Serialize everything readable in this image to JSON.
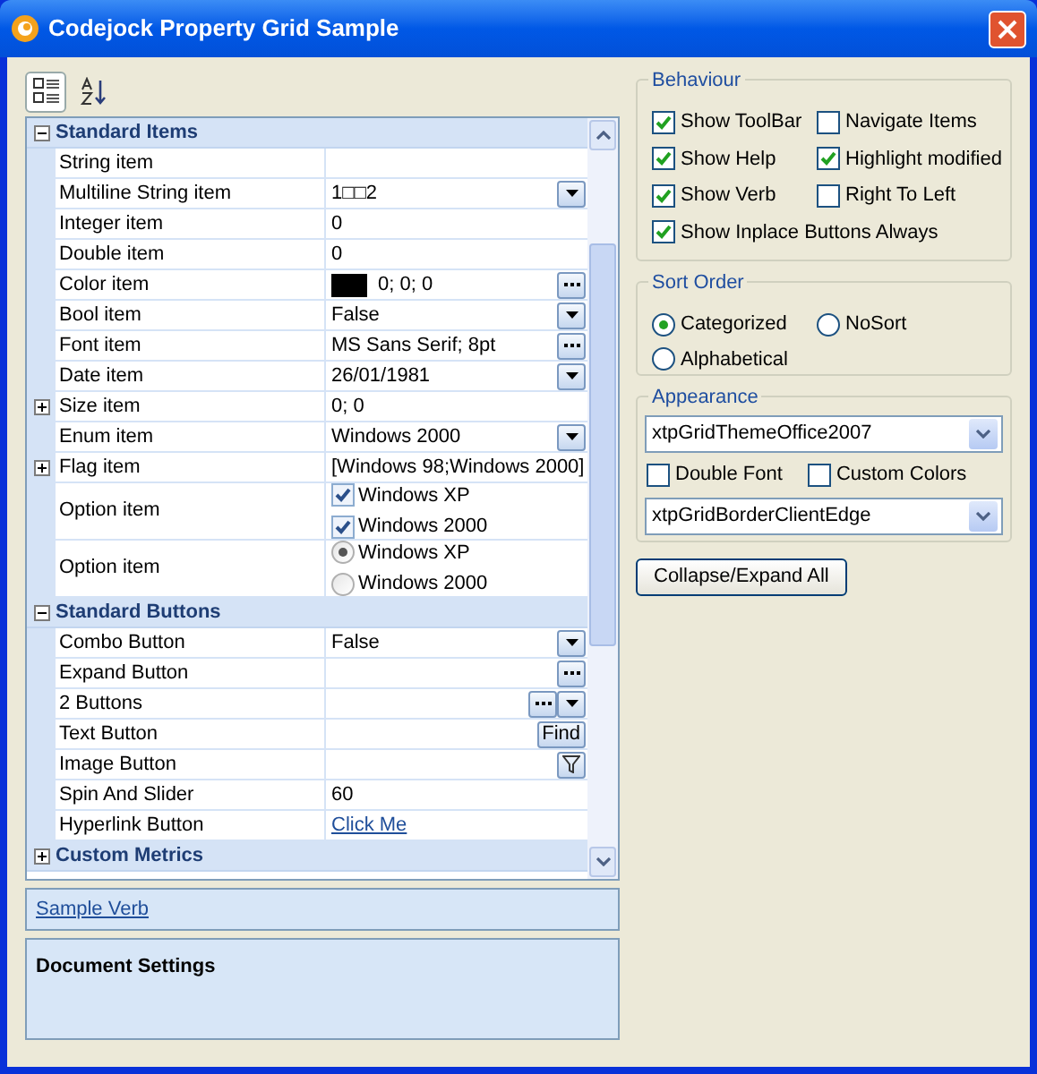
{
  "window": {
    "title": "Codejock Property Grid Sample"
  },
  "toolbar": [
    {
      "kind": "categorized",
      "selected": true
    },
    {
      "kind": "alphabetical",
      "selected": false
    }
  ],
  "grid": {
    "rows": [
      {
        "kind": "category",
        "label": "Standard Items",
        "expanded": true
      },
      {
        "kind": "item",
        "label": "String item",
        "value": ""
      },
      {
        "kind": "item",
        "label": "Multiline String item",
        "value": "1□□2",
        "buttons": [
          {
            "kind": "dropdown"
          }
        ]
      },
      {
        "kind": "item",
        "label": "Integer item",
        "value": "0"
      },
      {
        "kind": "item",
        "label": "Double item",
        "value": "0"
      },
      {
        "kind": "item",
        "label": "Color item",
        "value": "0; 0; 0",
        "color": "#000000",
        "buttons": [
          {
            "kind": "ellipsis"
          }
        ]
      },
      {
        "kind": "item",
        "label": "Bool item",
        "value": "False",
        "buttons": [
          {
            "kind": "dropdown"
          }
        ]
      },
      {
        "kind": "item",
        "label": "Font item",
        "value": "MS Sans Serif; 8pt",
        "buttons": [
          {
            "kind": "ellipsis"
          }
        ]
      },
      {
        "kind": "item",
        "label": "Date item",
        "value": "26/01/1981",
        "buttons": [
          {
            "kind": "dropdown"
          }
        ]
      },
      {
        "kind": "item",
        "label": "Size item",
        "value": "0; 0",
        "expanded": false
      },
      {
        "kind": "item",
        "label": "Enum item",
        "value": "Windows 2000",
        "buttons": [
          {
            "kind": "dropdown"
          }
        ]
      },
      {
        "kind": "item",
        "label": "Flag item",
        "value": "[Windows 98;Windows 2000]",
        "expanded": false
      },
      {
        "kind": "checks",
        "label": "Option item",
        "options": [
          {
            "label": "Windows XP",
            "checked": true
          },
          {
            "label": "Windows 2000",
            "checked": true
          }
        ]
      },
      {
        "kind": "radios",
        "label": "Option item",
        "options": [
          {
            "label": "Windows XP",
            "selected": true
          },
          {
            "label": "Windows 2000",
            "selected": false
          }
        ]
      },
      {
        "kind": "category",
        "label": "Standard Buttons",
        "expanded": true
      },
      {
        "kind": "item",
        "label": "Combo Button",
        "value": "False",
        "buttons": [
          {
            "kind": "dropdown"
          }
        ]
      },
      {
        "kind": "item",
        "label": "Expand Button",
        "value": "",
        "buttons": [
          {
            "kind": "ellipsis"
          }
        ]
      },
      {
        "kind": "item",
        "label": "2 Buttons",
        "value": "",
        "buttons": [
          {
            "kind": "ellipsis"
          },
          {
            "kind": "dropdown"
          }
        ]
      },
      {
        "kind": "item",
        "label": "Text Button",
        "value": "",
        "buttons": [
          {
            "kind": "text",
            "label": "Find"
          }
        ]
      },
      {
        "kind": "item",
        "label": "Image Button",
        "value": "",
        "buttons": [
          {
            "kind": "filter"
          }
        ]
      },
      {
        "kind": "item",
        "label": "Spin And Slider",
        "value": "60"
      },
      {
        "kind": "link",
        "label": "Hyperlink Button",
        "value": "Click Me"
      },
      {
        "kind": "category",
        "label": "Custom Metrics",
        "expanded": false
      }
    ]
  },
  "verb": "Sample Verb",
  "help": {
    "title": "Document Settings"
  },
  "behaviour": {
    "title": "Behaviour",
    "options": [
      {
        "label": "Show ToolBar",
        "checked": true
      },
      {
        "label": "Navigate Items",
        "checked": false
      },
      {
        "label": "Show Help",
        "checked": true
      },
      {
        "label": "Highlight modified",
        "checked": true
      },
      {
        "label": "Show Verb",
        "checked": true
      },
      {
        "label": "Right To Left",
        "checked": false
      },
      {
        "label": "Show Inplace Buttons Always",
        "checked": true
      }
    ]
  },
  "sort_order": {
    "title": "Sort Order",
    "options": [
      {
        "label": "Categorized",
        "selected": true
      },
      {
        "label": "NoSort",
        "selected": false
      },
      {
        "label": "Alphabetical",
        "selected": false
      }
    ]
  },
  "appearance": {
    "title": "Appearance",
    "theme": "xtpGridThemeOffice2007",
    "options": [
      {
        "label": "Double Font",
        "checked": false
      },
      {
        "label": "Custom Colors",
        "checked": false
      }
    ],
    "border": "xtpGridBorderClientEdge"
  },
  "collapse_button": "Collapse/Expand All"
}
